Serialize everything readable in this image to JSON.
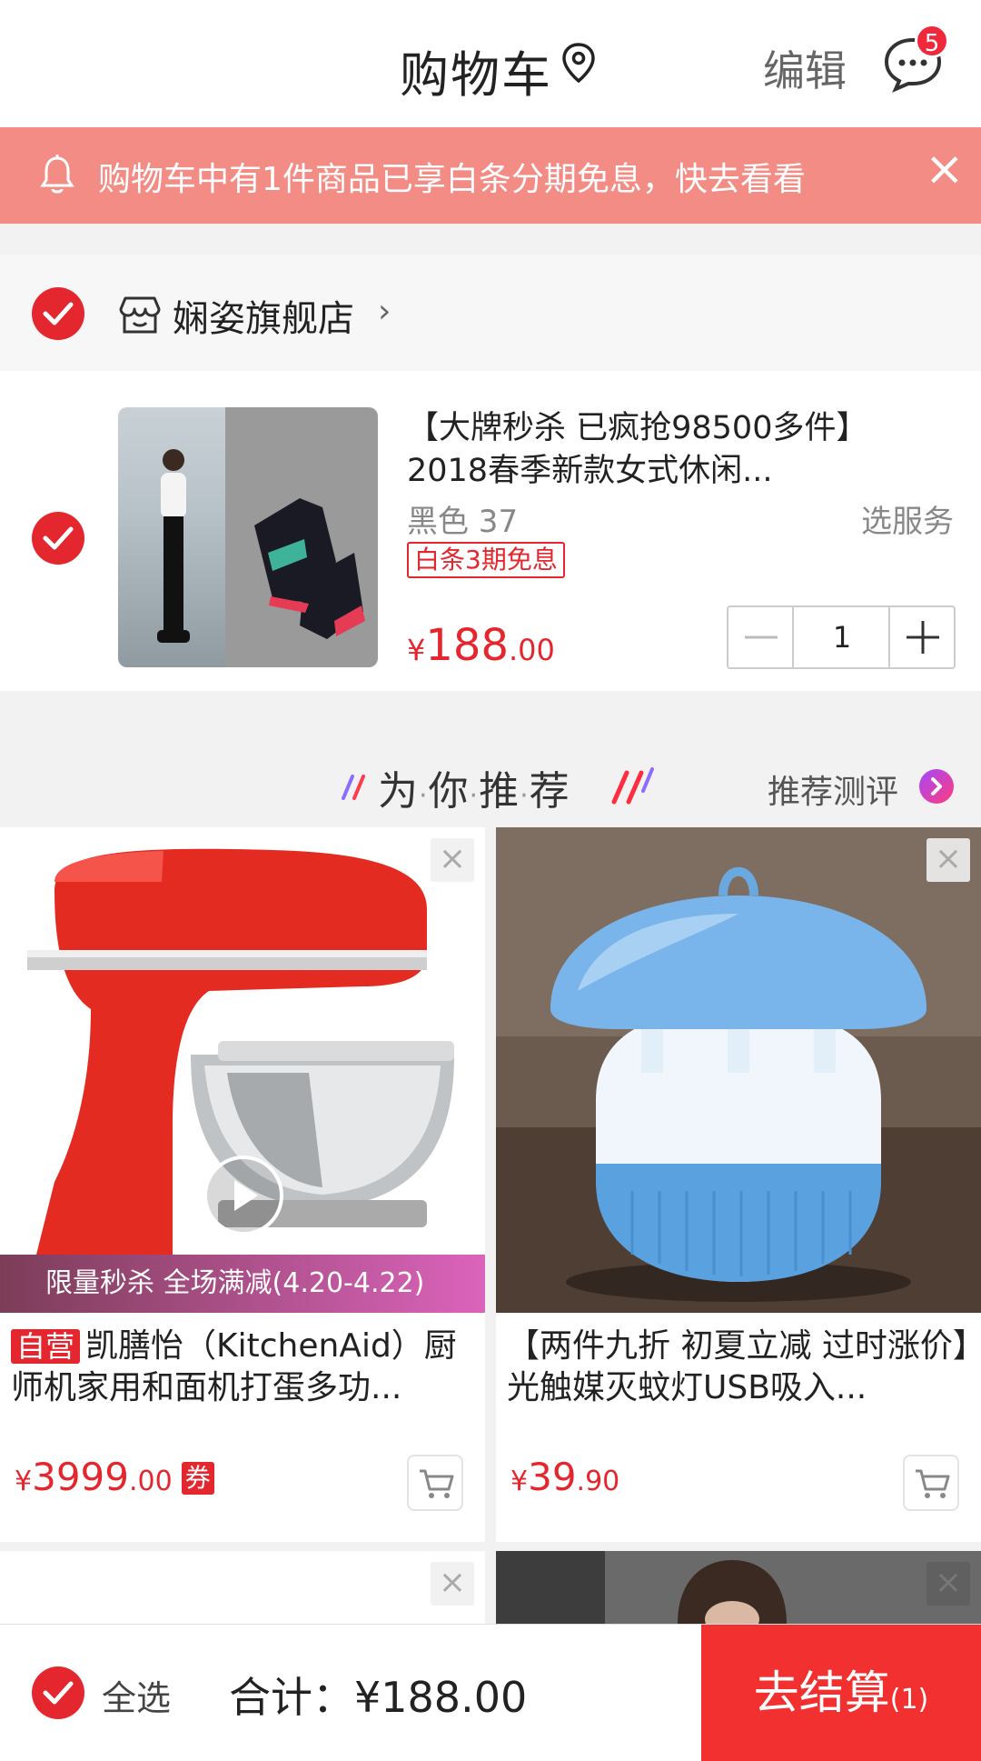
{
  "header": {
    "title": "购物车",
    "edit_label": "编辑",
    "message_badge": "5"
  },
  "notice": {
    "text": "购物车中有1件商品已享白条分期免息，快去看看",
    "close_label": "×"
  },
  "shop": {
    "name": "娴姿旗舰店",
    "arrow": "›"
  },
  "cart_item": {
    "title": "【大牌秒杀 已疯抢98500多件】2018春季新款女式休闲...",
    "spec": "黑色  37",
    "service_label": "选服务",
    "promo_tag": "白条3期免息",
    "price_currency": "¥",
    "price_int": "188",
    "price_dec": ".00",
    "quantity": "1"
  },
  "recommend": {
    "title_chars": [
      "为",
      "你",
      "推",
      "荐"
    ],
    "dot": "·",
    "review_label": "推荐测评"
  },
  "products": [
    {
      "self_tag": "自营",
      "name": "凯膳怡（KitchenAid）厨师机家用和面机打蛋多功...",
      "banner": "限量秒杀 全场满减(4.20-4.22)",
      "price_currency": "¥",
      "price_int": "3999",
      "price_dec": ".00",
      "coupon": "券"
    },
    {
      "name": "【两件九折 初夏立减 过时涨价】光触媒灭蚊灯USB吸入...",
      "price_currency": "¥",
      "price_int": "39",
      "price_dec": ".90"
    }
  ],
  "bottom": {
    "select_all_label": "全选",
    "total_label": "合计：¥188.00",
    "checkout_label": "去结算",
    "checkout_count": "(1)"
  },
  "colors": {
    "accent": "#e4272e",
    "notice_bg": "#f48c86",
    "checkout_bg": "#f23030"
  }
}
